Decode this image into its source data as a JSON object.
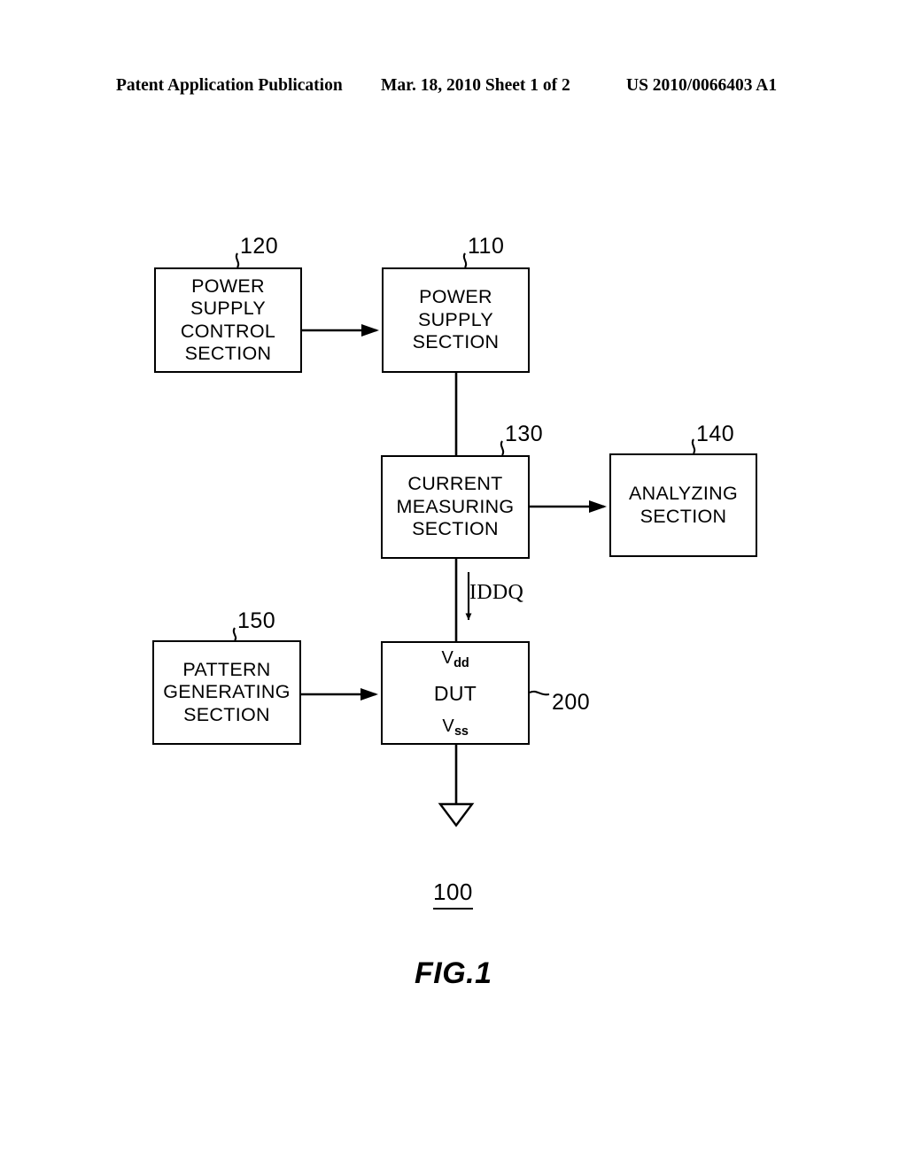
{
  "header": {
    "publication": "Patent Application Publication",
    "date_sheet": "Mar. 18, 2010  Sheet 1 of 2",
    "patent_number": "US 2010/0066403 A1"
  },
  "figure": {
    "label": "FIG.1",
    "system_reference": "100",
    "blocks": [
      {
        "ref": "120",
        "lines": [
          "POWER",
          "SUPPLY",
          "CONTROL",
          "SECTION"
        ]
      },
      {
        "ref": "110",
        "lines": [
          "POWER",
          "SUPPLY",
          "SECTION"
        ]
      },
      {
        "ref": "130",
        "lines": [
          "CURRENT",
          "MEASURING",
          "SECTION"
        ]
      },
      {
        "ref": "140",
        "lines": [
          "ANALYZING",
          "SECTION"
        ]
      },
      {
        "ref": "150",
        "lines": [
          "PATTERN",
          "GENERATING",
          "SECTION"
        ]
      },
      {
        "ref": "200",
        "top_terminal": "V",
        "top_terminal_sub": "dd",
        "name": "DUT",
        "bottom_terminal": "V",
        "bottom_terminal_sub": "ss"
      }
    ],
    "signal_labels": {
      "iddq": "IDDQ"
    },
    "ground_symbol": "ground-triangle"
  },
  "colors": {
    "ink": "#000000",
    "paper": "#ffffff"
  }
}
